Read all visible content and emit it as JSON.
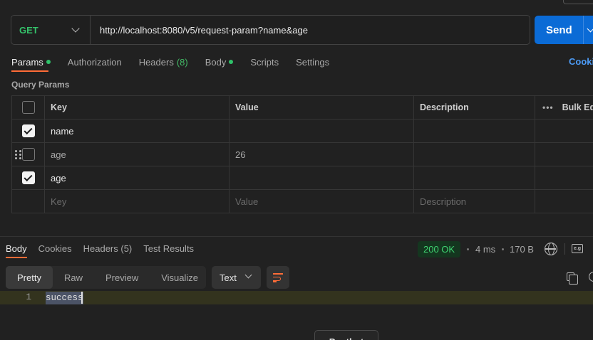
{
  "request": {
    "method": "GET",
    "url": "http://localhost:8080/v5/request-param?name&age",
    "send_label": "Send"
  },
  "request_tabs": [
    {
      "label": "Params",
      "has_dot": true,
      "active": true
    },
    {
      "label": "Authorization"
    },
    {
      "label": "Headers",
      "count": "(8)"
    },
    {
      "label": "Body",
      "has_dot": true
    },
    {
      "label": "Scripts"
    },
    {
      "label": "Settings"
    }
  ],
  "cookies_link": "Cooki",
  "query_params": {
    "title": "Query Params",
    "headers": {
      "key": "Key",
      "value": "Value",
      "description": "Description",
      "bulk_edit": "Bulk Edi"
    },
    "rows": [
      {
        "checked": true,
        "key": "name",
        "value": "",
        "description": ""
      },
      {
        "checked": false,
        "key": "age",
        "value": "26",
        "description": ""
      },
      {
        "checked": true,
        "key": "age",
        "value": "",
        "description": ""
      }
    ],
    "placeholder": {
      "key": "Key",
      "value": "Value",
      "description": "Description"
    }
  },
  "response_tabs": [
    {
      "label": "Body",
      "active": true
    },
    {
      "label": "Cookies"
    },
    {
      "label": "Headers (5)"
    },
    {
      "label": "Test Results"
    }
  ],
  "response_meta": {
    "status": "200 OK",
    "time": "4 ms",
    "size": "170 B"
  },
  "viewer": {
    "tabs": [
      "Pretty",
      "Raw",
      "Preview",
      "Visualize"
    ],
    "format": "Text"
  },
  "response_body": {
    "line_number": "1",
    "text": "success"
  },
  "bottom_button": "Postbot",
  "colors": {
    "accent": "#ff6c37",
    "send": "#0b6bd6",
    "status_ok": "#3fd371",
    "method_get": "#34c26a"
  },
  "icons": [
    "chevron-down-icon",
    "drag-handle-icon",
    "checkbox-icon",
    "more-icon",
    "globe-icon",
    "save-response-icon",
    "wrap-lines-icon",
    "copy-icon",
    "search-icon"
  ]
}
